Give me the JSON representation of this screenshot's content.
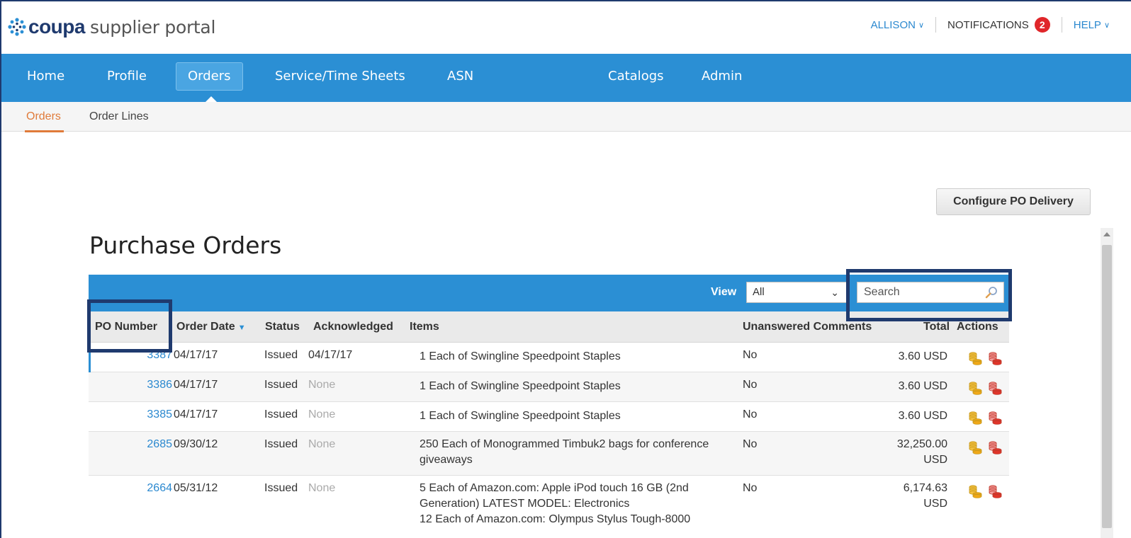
{
  "header": {
    "brand": "coupa",
    "product": "supplier portal",
    "user_label": "ALLISON",
    "notifications_label": "NOTIFICATIONS",
    "notifications_count": "2",
    "help_label": "HELP"
  },
  "nav": {
    "tabs": [
      {
        "label": "Home"
      },
      {
        "label": "Profile"
      },
      {
        "label": "Orders",
        "active": true
      },
      {
        "label": "Service/Time Sheets"
      },
      {
        "label": "ASN"
      },
      {
        "label": "Catalogs"
      },
      {
        "label": "Admin"
      }
    ]
  },
  "subnav": {
    "tabs": [
      {
        "label": "Orders",
        "active": true
      },
      {
        "label": "Order Lines"
      }
    ]
  },
  "configure_button": "Configure PO Delivery",
  "page_title": "Purchase Orders",
  "table": {
    "view_label": "View",
    "view_value": "All",
    "search_placeholder": "Search",
    "columns": [
      "PO Number",
      "Order Date",
      "Status",
      "Acknowledged",
      "Items",
      "Unanswered Comments",
      "Total",
      "Actions"
    ],
    "rows": [
      {
        "po": "3387",
        "date": "04/17/17",
        "status": "Issued",
        "ack": "04/17/17",
        "items": "1 Each of Swingline Speedpoint Staples",
        "comments": "No",
        "total_line1": "3.60 USD",
        "total_line2": ""
      },
      {
        "po": "3386",
        "date": "04/17/17",
        "status": "Issued",
        "ack": "None",
        "items": "1 Each of Swingline Speedpoint Staples",
        "comments": "No",
        "total_line1": "3.60 USD",
        "total_line2": ""
      },
      {
        "po": "3385",
        "date": "04/17/17",
        "status": "Issued",
        "ack": "None",
        "items": "1 Each of Swingline Speedpoint Staples",
        "comments": "No",
        "total_line1": "3.60 USD",
        "total_line2": ""
      },
      {
        "po": "2685",
        "date": "09/30/12",
        "status": "Issued",
        "ack": "None",
        "items": "250 Each of Monogrammed Timbuk2 bags for conference giveaways",
        "comments": "No",
        "total_line1": "32,250.00",
        "total_line2": "USD"
      },
      {
        "po": "2664",
        "date": "05/31/12",
        "status": "Issued",
        "ack": "None",
        "items": "5 Each of Amazon.com: Apple iPod touch 16 GB (2nd Generation) LATEST MODEL: Electronics",
        "items_extra": "12 Each of Amazon.com: Olympus Stylus Tough-8000",
        "comments": "No",
        "total_line1": "6,174.63",
        "total_line2": "USD"
      }
    ]
  },
  "icons": {
    "logo": "coupa-burst-icon",
    "search": "magnifier-icon",
    "action_1": "create-invoice-icon",
    "action_2": "create-credit-note-icon"
  },
  "colors": {
    "brand_blue": "#2b8fd4",
    "accent_orange": "#e07b3a",
    "badge_red": "#e0262a",
    "link_blue": "#2a88cf"
  }
}
